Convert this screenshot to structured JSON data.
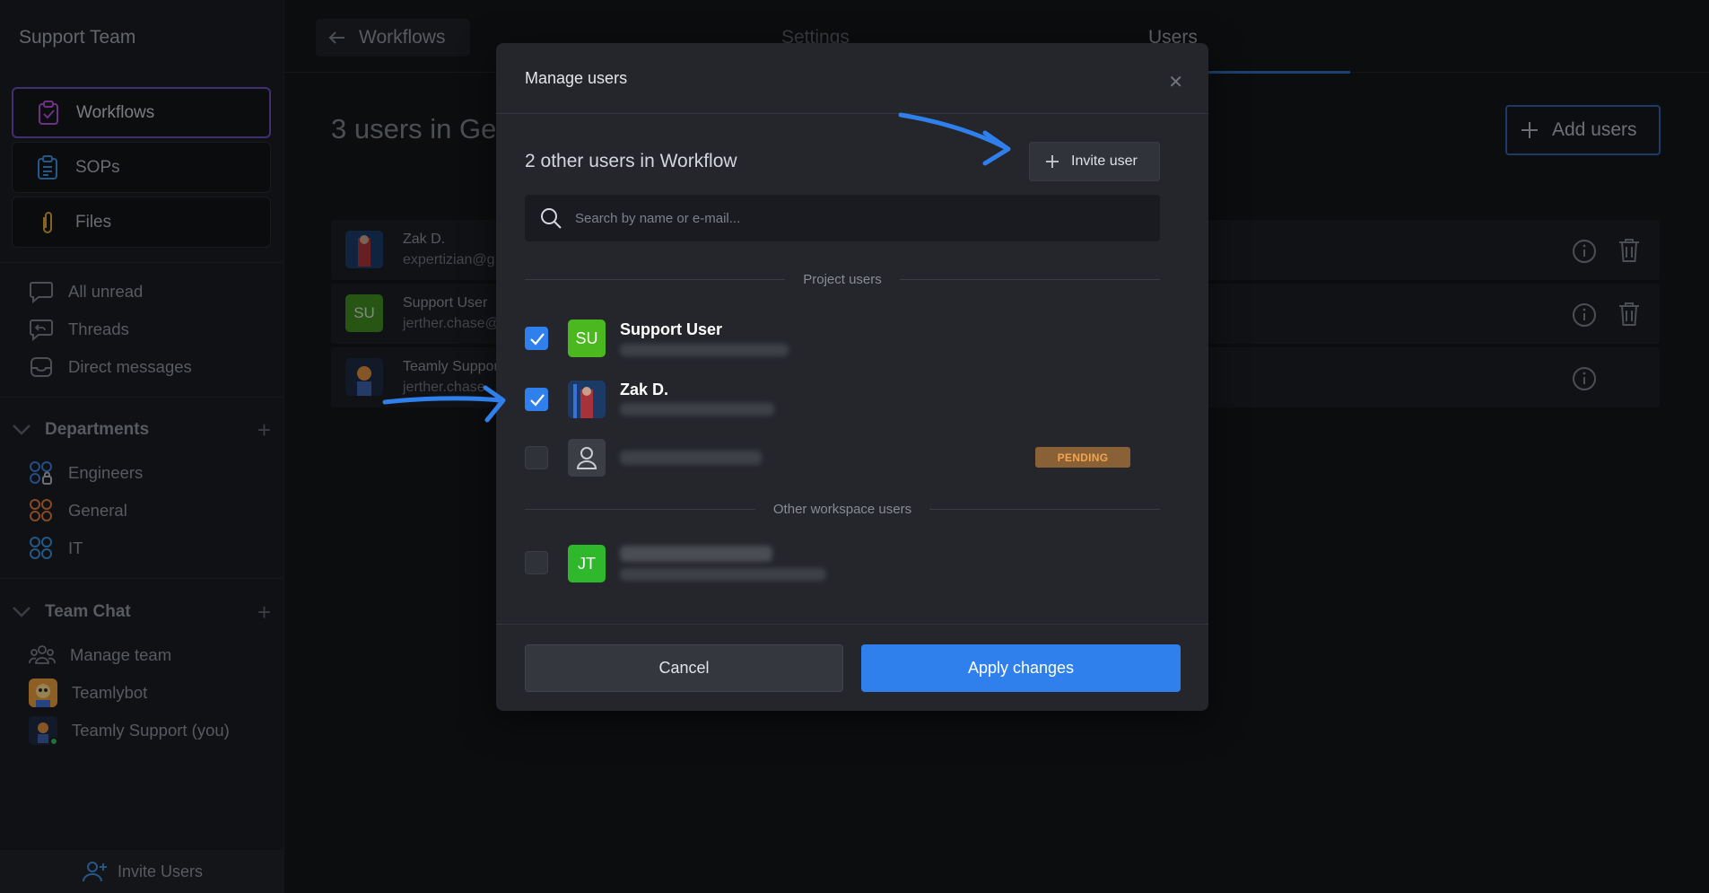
{
  "sidebar": {
    "team_name": "Support Team",
    "primary_nav": [
      {
        "label": "Workflows",
        "icon": "clipboard-check-icon"
      },
      {
        "label": "SOPs",
        "icon": "clipboard-list-icon"
      },
      {
        "label": "Files",
        "icon": "paperclip-icon"
      }
    ],
    "chat_nav": [
      {
        "label": "All unread",
        "icon": "chat-bubble-icon"
      },
      {
        "label": "Threads",
        "icon": "threads-icon"
      },
      {
        "label": "Direct messages",
        "icon": "inbox-icon"
      }
    ],
    "departments": {
      "title": "Departments",
      "items": [
        {
          "label": "Engineers",
          "icon": "group-icon",
          "color": "#3b7bd8"
        },
        {
          "label": "General",
          "icon": "group-icon",
          "color": "#d87a3b"
        },
        {
          "label": "IT",
          "icon": "group-icon",
          "color": "#3b8ed8"
        }
      ]
    },
    "team_chat": {
      "title": "Team Chat",
      "items": [
        {
          "label": "Manage team",
          "icon": "people-icon"
        },
        {
          "label": "Teamlybot",
          "icon": "bot-avatar"
        },
        {
          "label": "Teamly Support (you)",
          "icon": "user-avatar"
        }
      ]
    },
    "invite_label": "Invite Users"
  },
  "topbar": {
    "back_label": "Workflows",
    "tabs": [
      "Settings",
      "Users"
    ],
    "active_tab": "Users"
  },
  "main": {
    "title": "3 users in Ge",
    "add_users_label": "Add users",
    "rows": [
      {
        "name": "Zak D.",
        "email": "expertizian@g"
      },
      {
        "name": "Support User",
        "email": "jerther.chase@",
        "initials": "SU"
      },
      {
        "name": "Teamly Suppor",
        "email": "jerther.chase"
      }
    ]
  },
  "modal": {
    "title": "Manage users",
    "count_label": "2 other users in Workflow",
    "invite_label": "Invite user",
    "search_placeholder": "Search by name or e-mail...",
    "project_users_label": "Project users",
    "other_users_label": "Other workspace users",
    "project_users": [
      {
        "name": "Support User",
        "initials": "SU",
        "checked": true,
        "avatar_color": "#4cb81f"
      },
      {
        "name": "Zak D.",
        "checked": true
      },
      {
        "name": "",
        "checked": false,
        "status": "PENDING"
      }
    ],
    "other_users": [
      {
        "initials": "JT",
        "checked": false,
        "avatar_color": "#2fb82c"
      }
    ],
    "cancel_label": "Cancel",
    "apply_label": "Apply changes"
  },
  "colors": {
    "accent": "#2f80ed",
    "pending": "#f0a54f"
  }
}
